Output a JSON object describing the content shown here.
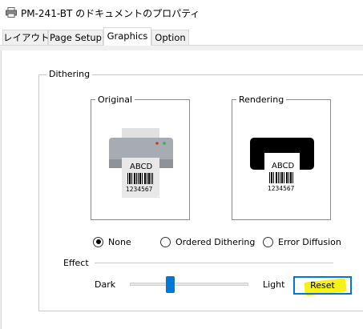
{
  "window": {
    "title": "PM-241-BT のドキュメントのプロパティ",
    "icon": "printer-icon"
  },
  "tabs": [
    {
      "label": "レイアウト",
      "active": false
    },
    {
      "label": "Page Setup",
      "active": false
    },
    {
      "label": "Graphics",
      "active": true
    },
    {
      "label": "Option",
      "active": false
    }
  ],
  "dithering": {
    "group_label": "Dithering",
    "original_label": "Original",
    "rendering_label": "Rendering",
    "sample_text": "ABCD",
    "barcode_number": "1234567",
    "options": [
      {
        "label": "None",
        "selected": true
      },
      {
        "label": "Ordered Dithering",
        "selected": false
      },
      {
        "label": "Error Diffusion",
        "selected": false
      }
    ]
  },
  "effect": {
    "label": "Effect",
    "dark_label": "Dark",
    "light_label": "Light",
    "slider_value": 0.3,
    "reset_label": "Reset"
  },
  "colors": {
    "accent": "#0078d7",
    "highlight": "#f5f000"
  }
}
